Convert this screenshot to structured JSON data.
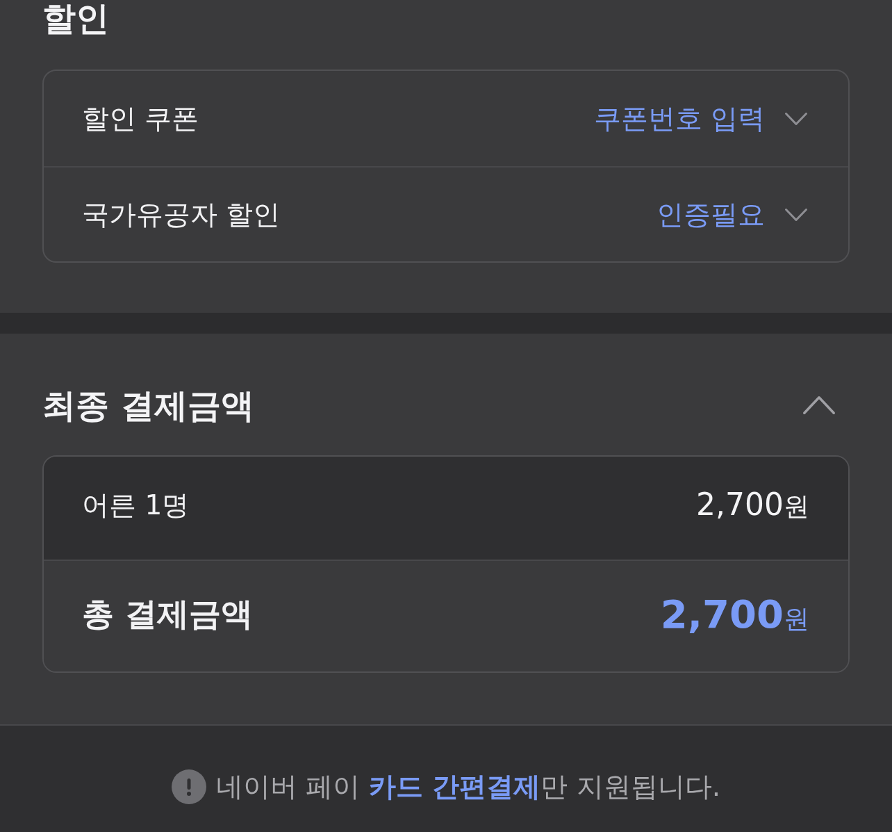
{
  "discount": {
    "title": "할인",
    "rows": [
      {
        "label": "할인 쿠폰",
        "value": "쿠폰번호 입력",
        "expanded": false
      },
      {
        "label": "국가유공자 할인",
        "value": "인증필요",
        "expanded": false
      }
    ]
  },
  "final_payment": {
    "title": "최종 결제금액",
    "expanded": true,
    "lines": [
      {
        "label": "어른 1명",
        "amount": "2,700",
        "unit": "원"
      }
    ],
    "total": {
      "label": "총 결제금액",
      "amount": "2,700",
      "unit": "원"
    }
  },
  "notice": {
    "text": "네이버 페이 **카드 간편결제**만 지원됩니다."
  }
}
